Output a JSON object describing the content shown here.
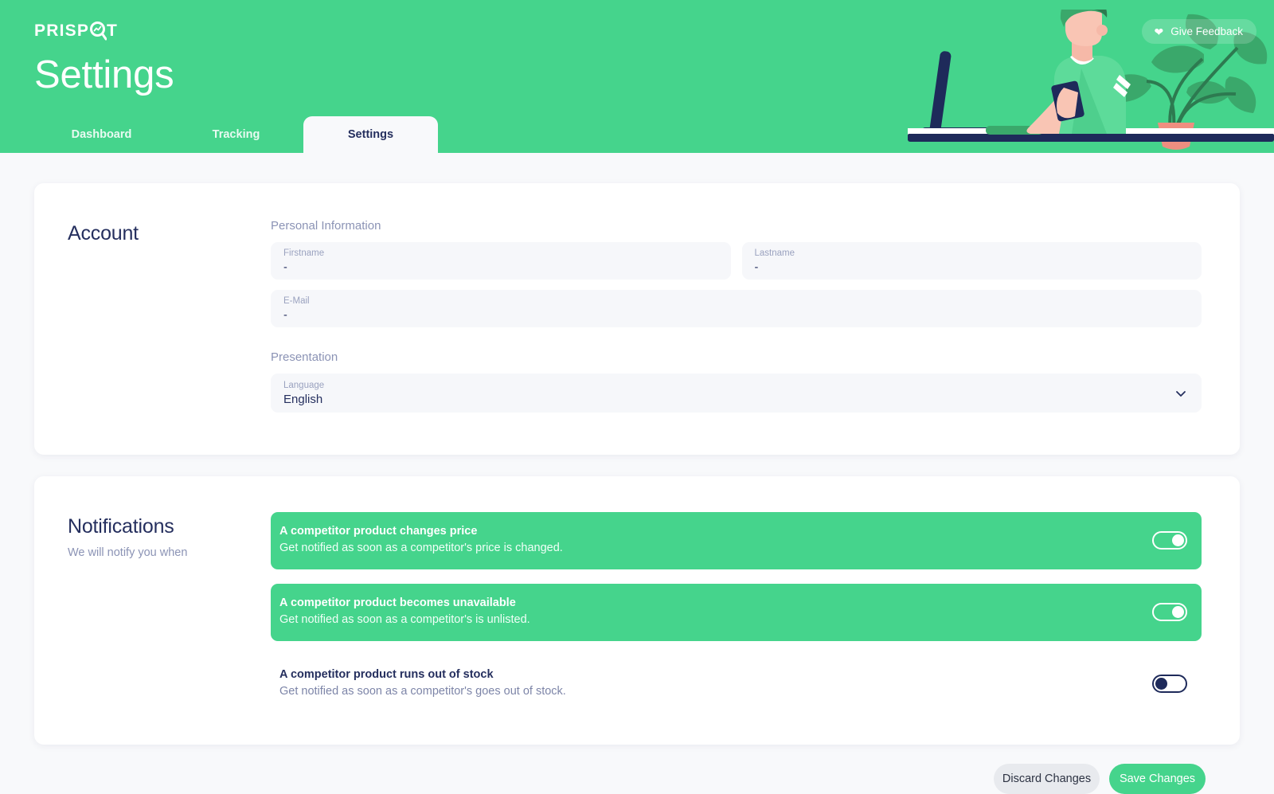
{
  "brand": {
    "logo_text_left": "PRISP",
    "logo_text_right": "T",
    "logo_icon": "magnifier-chart-icon",
    "accent_green": "#45d48c",
    "navy": "#252f5e",
    "page_bg": "#f8f9fb"
  },
  "header": {
    "title": "Settings",
    "feedback_button": "Give Feedback",
    "feedback_icon": "heart-icon",
    "illustration": "person-at-desk-with-monitor-and-plant"
  },
  "tabs": [
    {
      "label": "Dashboard",
      "active": false
    },
    {
      "label": "Tracking",
      "active": false
    },
    {
      "label": "Settings",
      "active": true
    }
  ],
  "account": {
    "title": "Account",
    "personal_information_label": "Personal Information",
    "presentation_label": "Presentation",
    "fields": {
      "firstname": {
        "label": "Firstname",
        "value": "-"
      },
      "lastname": {
        "label": "Lastname",
        "value": "-"
      },
      "email": {
        "label": "E-Mail",
        "value": "-"
      },
      "language": {
        "label": "Language",
        "value": "English",
        "icon": "chevron-down-icon"
      }
    }
  },
  "notifications": {
    "title": "Notifications",
    "subtitle": "We will notify you when",
    "items": [
      {
        "title": "A competitor product changes price",
        "description": "Get notified as soon as a competitor's price is changed.",
        "enabled": true
      },
      {
        "title": "A competitor product becomes unavailable",
        "description": "Get notified as soon as a competitor's is unlisted.",
        "enabled": true
      },
      {
        "title": "A competitor product runs out of stock",
        "description": "Get notified as soon as a competitor's goes out of stock.",
        "enabled": false
      }
    ]
  },
  "actions": {
    "discard": "Discard Changes",
    "save": "Save Changes"
  }
}
